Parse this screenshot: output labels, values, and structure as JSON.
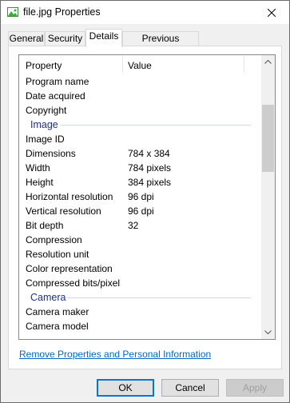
{
  "window": {
    "title": "file.jpg Properties",
    "icon": "image-file-icon"
  },
  "tabs": [
    {
      "label": "General"
    },
    {
      "label": "Security"
    },
    {
      "label": "Details",
      "active": true
    },
    {
      "label": "Previous Versions"
    }
  ],
  "details": {
    "headers": {
      "property": "Property",
      "value": "Value"
    },
    "top_rows": [
      {
        "property": "Program name",
        "value": ""
      },
      {
        "property": "Date acquired",
        "value": ""
      },
      {
        "property": "Copyright",
        "value": ""
      }
    ],
    "groups": {
      "image": "Image",
      "camera": "Camera"
    },
    "image_rows": [
      {
        "property": "Image ID",
        "value": ""
      },
      {
        "property": "Dimensions",
        "value": "784 x 384"
      },
      {
        "property": "Width",
        "value": "784 pixels"
      },
      {
        "property": "Height",
        "value": "384 pixels"
      },
      {
        "property": "Horizontal resolution",
        "value": "96 dpi"
      },
      {
        "property": "Vertical resolution",
        "value": "96 dpi"
      },
      {
        "property": "Bit depth",
        "value": "32"
      },
      {
        "property": "Compression",
        "value": ""
      },
      {
        "property": "Resolution unit",
        "value": ""
      },
      {
        "property": "Color representation",
        "value": ""
      },
      {
        "property": "Compressed bits/pixel",
        "value": ""
      }
    ],
    "camera_rows": [
      {
        "property": "Camera maker",
        "value": ""
      },
      {
        "property": "Camera model",
        "value": ""
      }
    ]
  },
  "link": {
    "remove_properties": "Remove Properties and Personal Information"
  },
  "buttons": {
    "ok": "OK",
    "cancel": "Cancel",
    "apply": "Apply"
  },
  "colors": {
    "group_header": "#1e3287",
    "link": "#0066cc",
    "focus_border": "#0078d7"
  }
}
